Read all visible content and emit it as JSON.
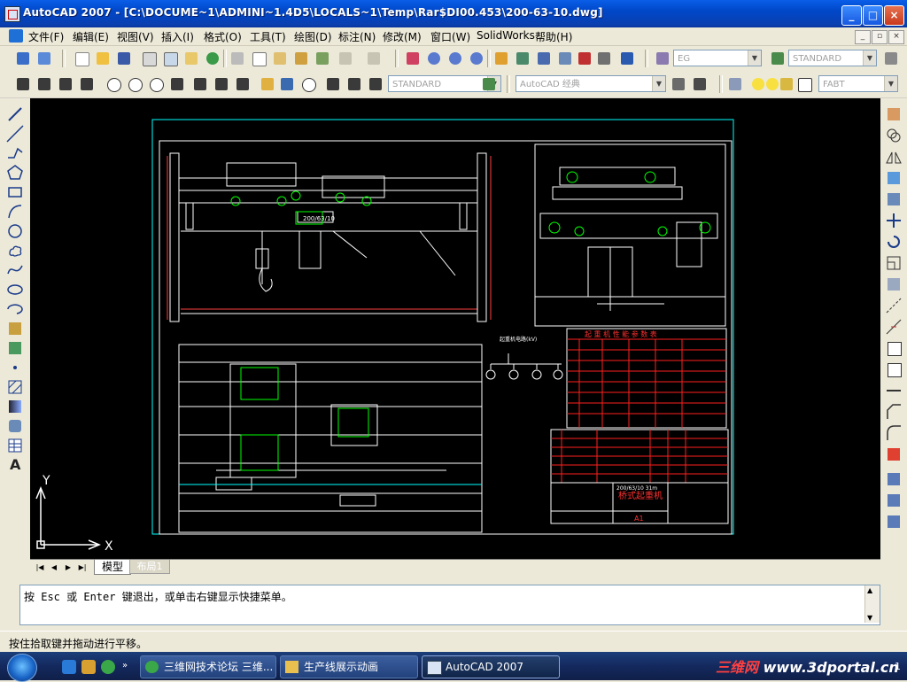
{
  "window": {
    "title": "AutoCAD 2007 - [C:\\DOCUME~1\\ADMINI~1.4D5\\LOCALS~1\\Temp\\Rar$DI00.453\\200-63-10.dwg]",
    "btn_min": "_",
    "btn_max": "□",
    "btn_close": "×"
  },
  "menu": {
    "items": [
      "文件(F)",
      "编辑(E)",
      "视图(V)",
      "插入(I)",
      "格式(O)",
      "工具(T)",
      "绘图(D)",
      "标注(N)",
      "修改(M)",
      "窗口(W)",
      "SolidWorks",
      "帮助(H)"
    ],
    "mdi_min": "_",
    "mdi_restore": "▫",
    "mdi_close": "×"
  },
  "toolbar1": {
    "text_style": "EG",
    "dim_style": "STANDARD"
  },
  "toolbar2": {
    "table_style": "STANDARD",
    "workspace": "AutoCAD 经典",
    "layer": "FABT"
  },
  "drawing": {
    "label_load": "200/63/10",
    "title_block_name": "桥式起重机",
    "title_block_code": "200/63/10 31m",
    "title_block_sheet": "A1",
    "table_header": "起 重 机 性 能 参 数 表",
    "circuit_label": "起重机电路(kV)"
  },
  "ucs": {
    "x": "X",
    "y": "Y"
  },
  "tabs": {
    "model": "模型",
    "layout": "布局1"
  },
  "command": {
    "line": "按 Esc 或 Enter 键退出，或单击右键显示快捷菜单。"
  },
  "status": {
    "text": "按住拾取键并拖动进行平移。"
  },
  "taskbar": {
    "items": [
      "三维网技术论坛 三维...",
      "生产线展示动画",
      "AutoCAD 2007"
    ],
    "brand_prefix": "三维网",
    "brand_suffix": "www.3dportal.cn",
    "clock": "1"
  },
  "colors": {
    "canvas": "#000000",
    "drawing_lines": "#ffffff",
    "cyan": "#00ffff",
    "green": "#00ff00",
    "red": "#ff0000",
    "titlebar": "#0a4fd8"
  }
}
